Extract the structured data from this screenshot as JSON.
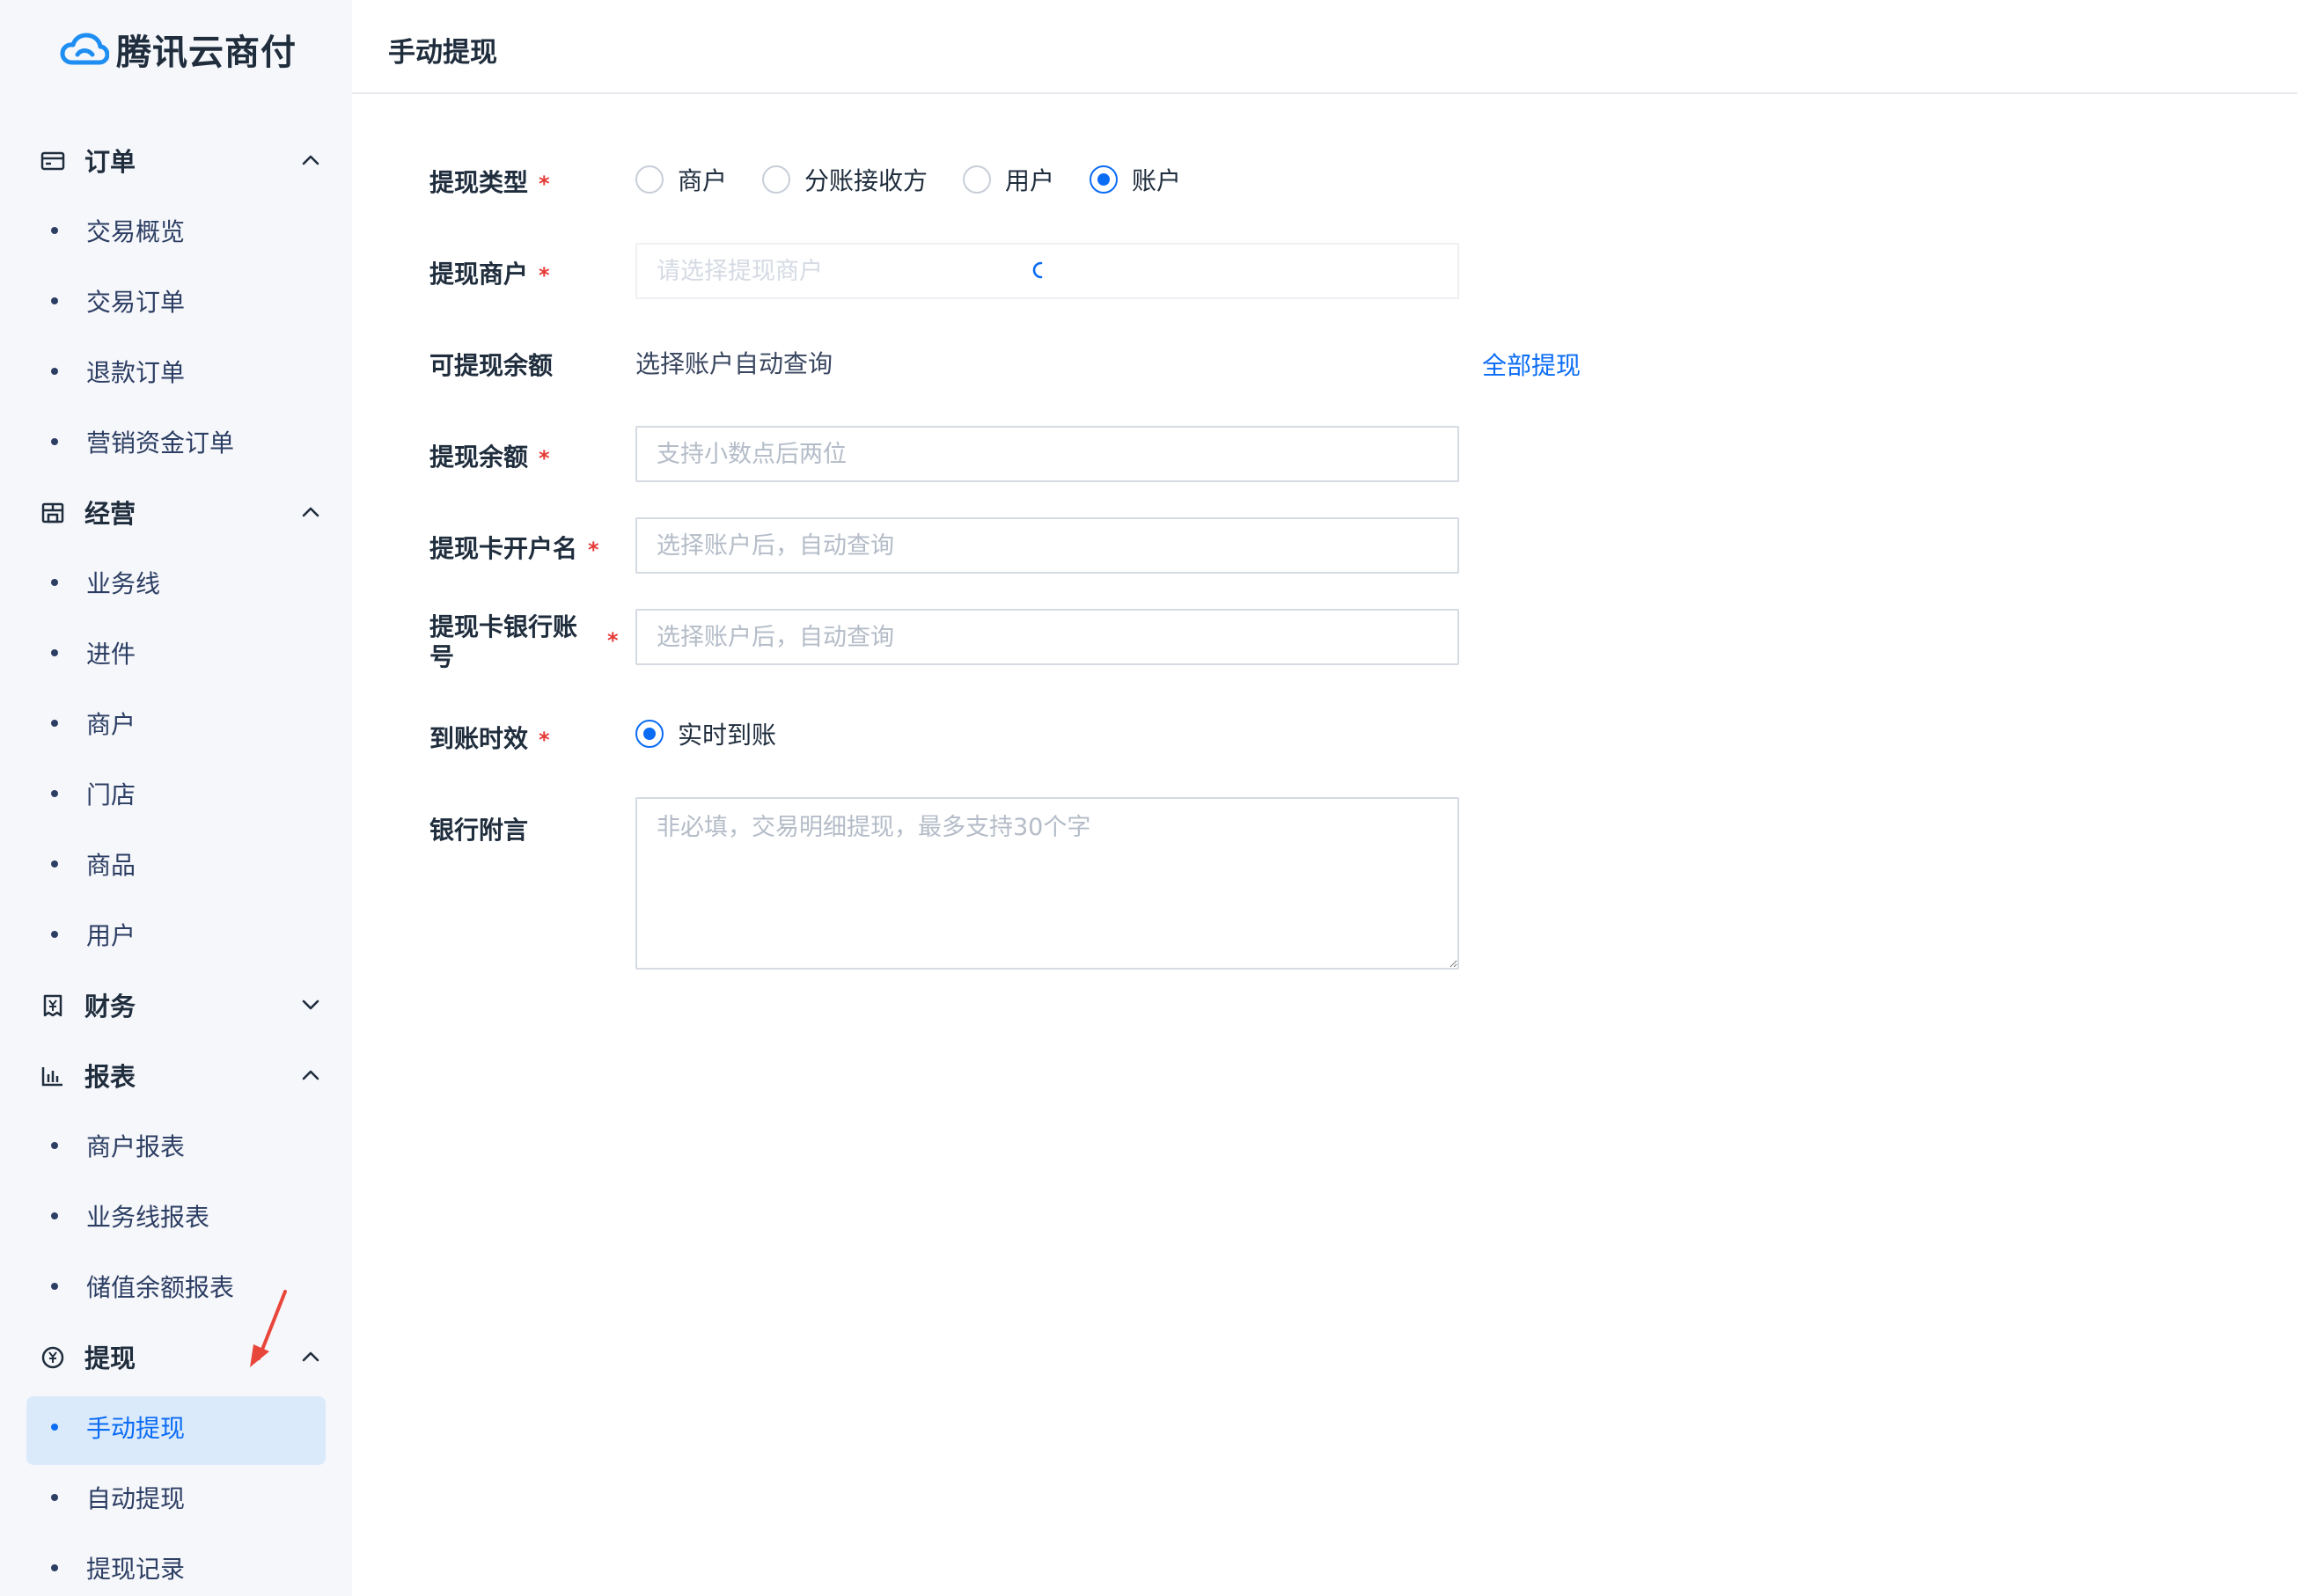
{
  "brand": {
    "name": "腾讯云商付"
  },
  "sidebar": {
    "groups": [
      {
        "label": "订单",
        "icon": "card-icon",
        "expanded": true,
        "items": [
          {
            "label": "交易概览"
          },
          {
            "label": "交易订单"
          },
          {
            "label": "退款订单"
          },
          {
            "label": "营销资金订单"
          }
        ]
      },
      {
        "label": "经营",
        "icon": "store-icon",
        "expanded": true,
        "items": [
          {
            "label": "业务线"
          },
          {
            "label": "进件"
          },
          {
            "label": "商户"
          },
          {
            "label": "门店"
          },
          {
            "label": "商品"
          },
          {
            "label": "用户"
          }
        ]
      },
      {
        "label": "财务",
        "icon": "yen-receipt-icon",
        "expanded": false,
        "items": []
      },
      {
        "label": "报表",
        "icon": "bar-chart-icon",
        "expanded": true,
        "items": [
          {
            "label": "商户报表"
          },
          {
            "label": "业务线报表"
          },
          {
            "label": "储值余额报表"
          }
        ]
      },
      {
        "label": "提现",
        "icon": "yen-circle-icon",
        "expanded": true,
        "items": [
          {
            "label": "手动提现",
            "active": true
          },
          {
            "label": "自动提现"
          },
          {
            "label": "提现记录"
          }
        ]
      }
    ]
  },
  "header": {
    "title": "手动提现"
  },
  "form": {
    "withdraw_type": {
      "label": "提现类型",
      "options": [
        {
          "label": "商户"
        },
        {
          "label": "分账接收方"
        },
        {
          "label": "用户"
        },
        {
          "label": "账户",
          "checked": true
        }
      ]
    },
    "merchant": {
      "label": "提现商户",
      "placeholder": "请选择提现商户"
    },
    "available_balance": {
      "label": "可提现余额",
      "value": "选择账户自动查询",
      "action": "全部提现"
    },
    "amount": {
      "label": "提现余额",
      "placeholder": "支持小数点后两位"
    },
    "account_name": {
      "label": "提现卡开户名",
      "placeholder": "选择账户后，自动查询"
    },
    "bank_account": {
      "label_line1": "提现卡银行账",
      "label_line2": "号",
      "placeholder": "选择账户后，自动查询"
    },
    "arrival": {
      "label": "到账时效",
      "option": "实时到账"
    },
    "remark": {
      "label": "银行附言",
      "placeholder": "非必填，交易明细提现，最多支持30个字"
    },
    "required_mark": "*"
  },
  "colors": {
    "accent": "#0a6cf5",
    "required": "#e53935",
    "sidebar_bg": "#f6f7fb",
    "active_bg": "#dbeafb"
  }
}
